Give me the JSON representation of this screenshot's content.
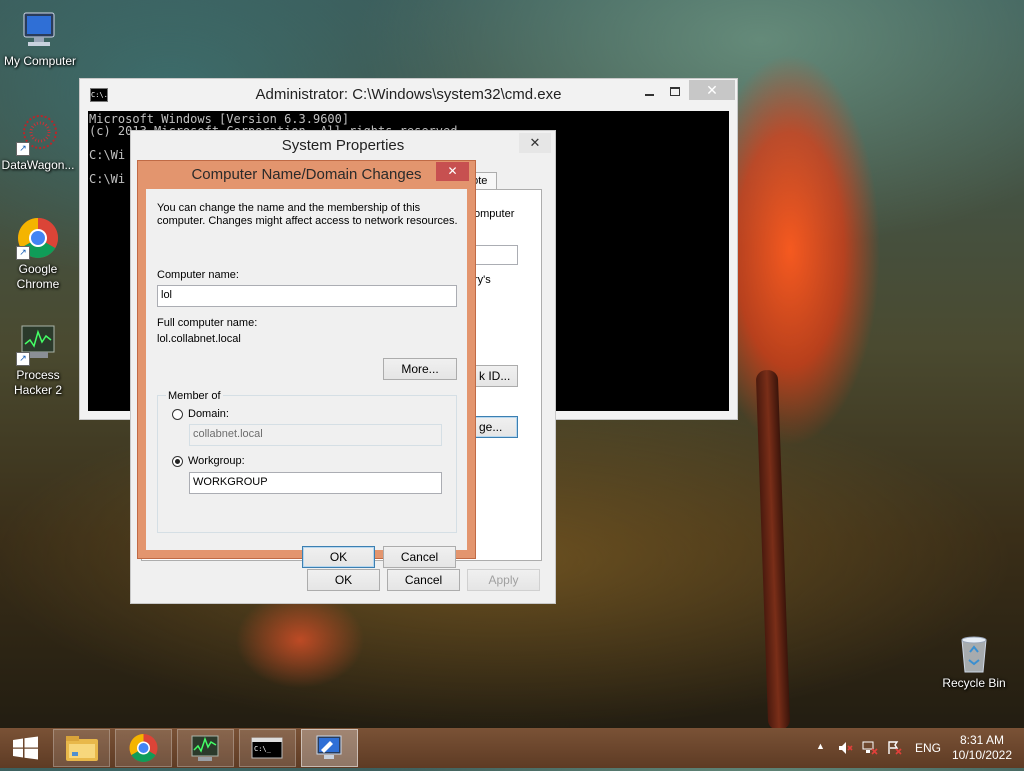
{
  "desktop": {
    "icons": [
      {
        "label": "My Computer"
      },
      {
        "label": "DataWagon..."
      },
      {
        "label": "Google Chrome"
      },
      {
        "label": "Process Hacker 2"
      },
      {
        "label": "Recycle Bin"
      }
    ]
  },
  "cmd_window": {
    "title": "Administrator: C:\\Windows\\system32\\cmd.exe",
    "icon_text": "C:\\.",
    "lines": [
      "Microsoft Windows [Version 6.3.9600]",
      "(c) 2013 Microsoft Corporation. All rights reserved.",
      "",
      "C:\\Wi",
      "",
      "C:\\Wi"
    ]
  },
  "system_properties": {
    "title": "System Properties",
    "tab_partial": "note",
    "partial_texts": [
      "omputer",
      "ry's",
      "k ID...",
      "ge..."
    ],
    "ok_label": "OK",
    "cancel_label": "Cancel",
    "apply_label": "Apply"
  },
  "name_dialog": {
    "title": "Computer Name/Domain Changes",
    "description": "You can change the name and the membership of this computer. Changes might affect access to network resources.",
    "computer_name_label": "Computer name:",
    "computer_name_value": "lol",
    "full_name_label": "Full computer name:",
    "full_name_value": "lol.collabnet.local",
    "more_label": "More...",
    "member_of_label": "Member of",
    "domain_label": "Domain:",
    "domain_value": "collabnet.local",
    "workgroup_label": "Workgroup:",
    "workgroup_value": "WORKGROUP",
    "selected_membership": "workgroup",
    "ok_label": "OK",
    "cancel_label": "Cancel"
  },
  "taskbar": {
    "language": "ENG",
    "time": "8:31 AM",
    "date": "10/10/2022"
  }
}
